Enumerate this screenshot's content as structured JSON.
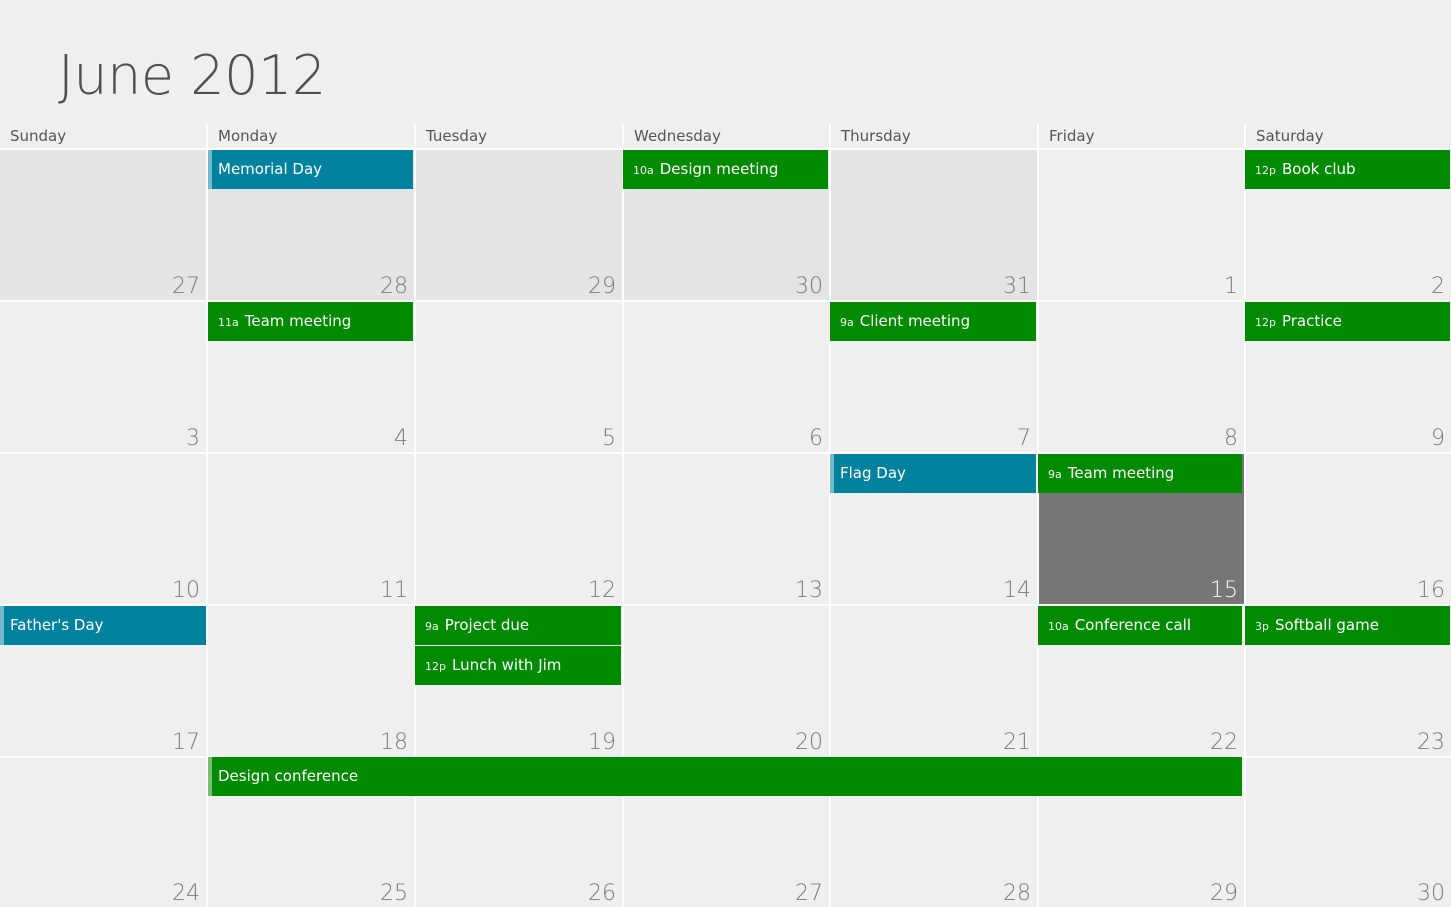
{
  "header": {
    "title": "June 2012"
  },
  "weekdays": [
    "Sunday",
    "Monday",
    "Tuesday",
    "Wednesday",
    "Thursday",
    "Friday",
    "Saturday"
  ],
  "weeks": [
    [
      "27",
      "28",
      "29",
      "30",
      "31",
      "1",
      "2"
    ],
    [
      "3",
      "4",
      "5",
      "6",
      "7",
      "8",
      "9"
    ],
    [
      "10",
      "11",
      "12",
      "13",
      "14",
      "15",
      "16"
    ],
    [
      "17",
      "18",
      "19",
      "20",
      "21",
      "22",
      "23"
    ],
    [
      "24",
      "25",
      "26",
      "27",
      "28",
      "29",
      "30"
    ]
  ],
  "events": {
    "memorial_day": {
      "title": "Memorial Day",
      "time": ""
    },
    "design_meeting": {
      "title": "Design meeting",
      "time": "10a"
    },
    "book_club": {
      "title": "Book club",
      "time": "12p"
    },
    "team_meeting_1": {
      "title": "Team meeting",
      "time": "11a"
    },
    "client_meeting": {
      "title": "Client meeting",
      "time": "9a"
    },
    "practice": {
      "title": "Practice",
      "time": "12p"
    },
    "flag_day": {
      "title": "Flag Day",
      "time": ""
    },
    "team_meeting_2": {
      "title": "Team meeting",
      "time": "9a"
    },
    "fathers_day": {
      "title": "Father's Day",
      "time": ""
    },
    "project_due": {
      "title": "Project due",
      "time": "9a"
    },
    "lunch_with_jim": {
      "title": "Lunch with Jim",
      "time": "12p"
    },
    "conference_call": {
      "title": "Conference call",
      "time": "10a"
    },
    "softball_game": {
      "title": "Softball game",
      "time": "3p"
    },
    "design_conference": {
      "title": "Design conference",
      "time": ""
    }
  },
  "colors": {
    "background": "#efefef",
    "prev_month_cell": "#e4e4e4",
    "today_cell": "#767676",
    "event_green": "#008a00",
    "event_teal": "#00819e"
  }
}
